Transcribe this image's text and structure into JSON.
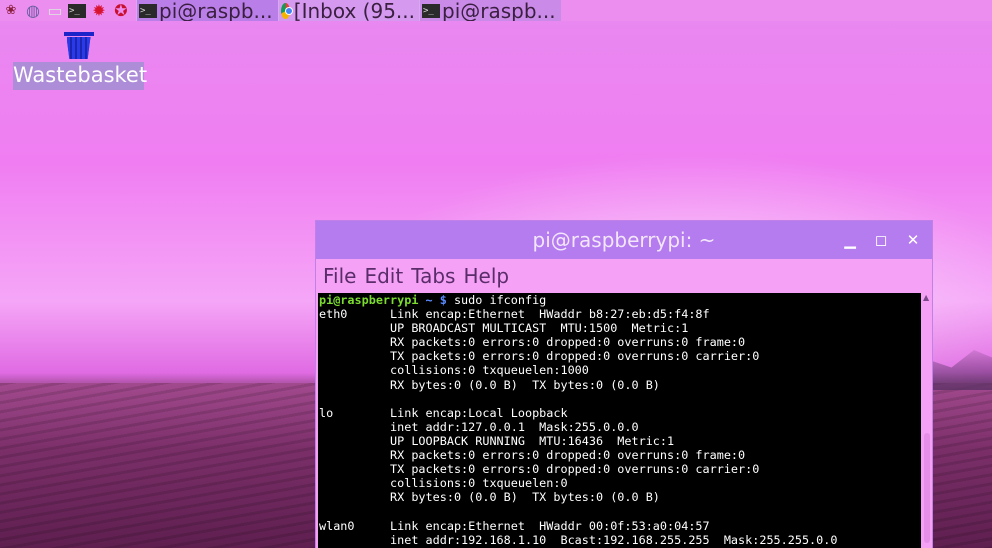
{
  "taskbar": {
    "launchers": [
      {
        "icon": "raspberry-icon",
        "glyph": "❀"
      },
      {
        "icon": "globe-icon",
        "glyph": "◍"
      },
      {
        "icon": "file-manager-icon",
        "glyph": "▭"
      },
      {
        "icon": "terminal-icon",
        "glyph": ">_"
      },
      {
        "icon": "mathematica-icon",
        "glyph": "✹"
      },
      {
        "icon": "wolfram-icon",
        "glyph": "✪"
      }
    ],
    "tasks": [
      {
        "label": "pi@raspb...",
        "icon": "terminal-icon",
        "active": true
      },
      {
        "label": "[Inbox (95...",
        "icon": "chrome-icon",
        "active": false
      },
      {
        "label": "pi@raspb...",
        "icon": "terminal-icon",
        "active": false
      }
    ]
  },
  "desktop": {
    "icons": [
      {
        "label": "Wastebasket",
        "icon": "wastebasket-icon"
      }
    ]
  },
  "window": {
    "title": "pi@raspberrypi: ~",
    "menu": [
      "File",
      "Edit",
      "Tabs",
      "Help"
    ],
    "prompt": {
      "user": "pi@raspberrypi",
      "path": " ~ $ ",
      "command": "sudo ifconfig"
    },
    "output": [
      "eth0      Link encap:Ethernet  HWaddr b8:27:eb:d5:f4:8f",
      "          UP BROADCAST MULTICAST  MTU:1500  Metric:1",
      "          RX packets:0 errors:0 dropped:0 overruns:0 frame:0",
      "          TX packets:0 errors:0 dropped:0 overruns:0 carrier:0",
      "          collisions:0 txqueuelen:1000",
      "          RX bytes:0 (0.0 B)  TX bytes:0 (0.0 B)",
      "",
      "lo        Link encap:Local Loopback",
      "          inet addr:127.0.0.1  Mask:255.0.0.0",
      "          UP LOOPBACK RUNNING  MTU:16436  Metric:1",
      "          RX packets:0 errors:0 dropped:0 overruns:0 frame:0",
      "          TX packets:0 errors:0 dropped:0 overruns:0 carrier:0",
      "          collisions:0 txqueuelen:0",
      "          RX bytes:0 (0.0 B)  TX bytes:0 (0.0 B)",
      "",
      "wlan0     Link encap:Ethernet  HWaddr 00:0f:53:a0:04:57",
      "          inet addr:192.168.1.10  Bcast:192.168.255.255  Mask:255.255.0.0"
    ]
  }
}
